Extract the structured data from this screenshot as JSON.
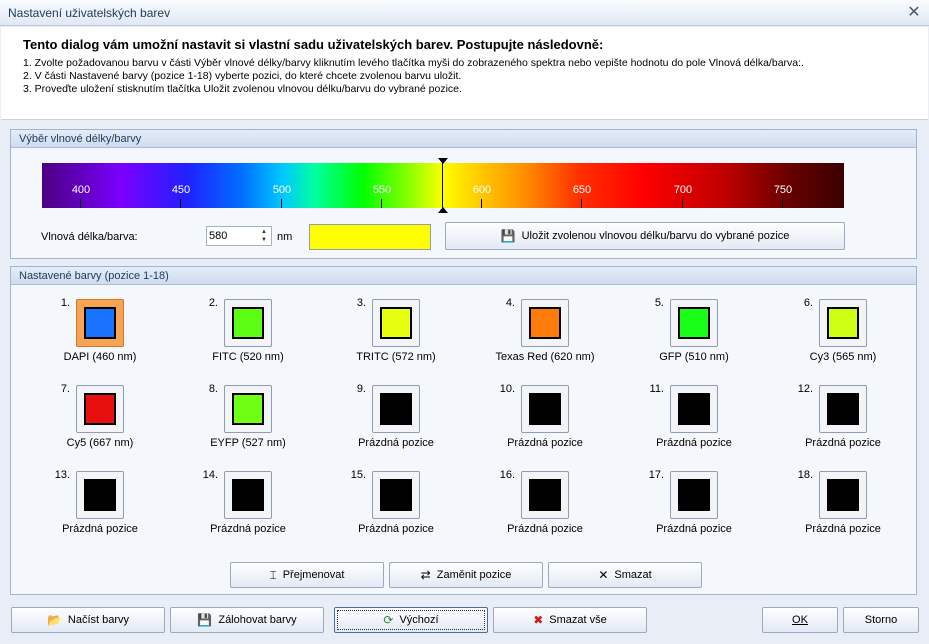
{
  "window": {
    "title": "Nastavení uživatelských barev"
  },
  "info": {
    "heading": "Tento dialog vám umožní nastavit si vlastní sadu uživatelských barev. Postupujte následovně:",
    "line1": "1. Zvolte požadovanou barvu v části Výběr vlnové délky/barvy kliknutím levého tlačítka myši do zobrazeného spektra nebo vepište hodnotu do pole Vlnová délka/barva:.",
    "line2": "2. V části Nastavené barvy (pozice 1-18) vyberte pozici, do které chcete zvolenou barvu uložit.",
    "line3": "3. Proveďte uložení stisknutím tlačítka Uložit zvolenou vlnovou délku/barvu do vybrané pozice."
  },
  "picker": {
    "title": "Výběr vlnové délky/barvy",
    "ticks": [
      "400",
      "450",
      "500",
      "550",
      "600",
      "650",
      "700",
      "750"
    ],
    "wavelength_label": "Vlnová délka/barva:",
    "wavelength_value": "580",
    "unit": "nm",
    "selected_color": "#ffff00",
    "save_button": "Uložit zvolenou vlnovou délku/barvu do vybrané pozice"
  },
  "presets": {
    "title": "Nastavené barvy (pozice 1-18)",
    "slots": [
      {
        "num": "1.",
        "name": "DAPI (460 nm)",
        "color": "#1a73ff"
      },
      {
        "num": "2.",
        "name": "FITC (520 nm)",
        "color": "#5cff14"
      },
      {
        "num": "3.",
        "name": "TRITC (572 nm)",
        "color": "#e6ff10"
      },
      {
        "num": "4.",
        "name": "Texas Red (620 nm)",
        "color": "#ff7b0a"
      },
      {
        "num": "5.",
        "name": "GFP (510 nm)",
        "color": "#1aff1a"
      },
      {
        "num": "6.",
        "name": "Cy3 (565 nm)",
        "color": "#ccff14"
      },
      {
        "num": "7.",
        "name": "Cy5 (667 nm)",
        "color": "#e80f0f"
      },
      {
        "num": "8.",
        "name": "EYFP (527 nm)",
        "color": "#6eff14"
      },
      {
        "num": "9.",
        "name": "Prázdná pozice",
        "color": "#000000"
      },
      {
        "num": "10.",
        "name": "Prázdná pozice",
        "color": "#000000"
      },
      {
        "num": "11.",
        "name": "Prázdná pozice",
        "color": "#000000"
      },
      {
        "num": "12.",
        "name": "Prázdná pozice",
        "color": "#000000"
      },
      {
        "num": "13.",
        "name": "Prázdná pozice",
        "color": "#000000"
      },
      {
        "num": "14.",
        "name": "Prázdná pozice",
        "color": "#000000"
      },
      {
        "num": "15.",
        "name": "Prázdná pozice",
        "color": "#000000"
      },
      {
        "num": "16.",
        "name": "Prázdná pozice",
        "color": "#000000"
      },
      {
        "num": "17.",
        "name": "Prázdná pozice",
        "color": "#000000"
      },
      {
        "num": "18.",
        "name": "Prázdná pozice",
        "color": "#000000"
      }
    ],
    "rename_button": "Přejmenovat",
    "swap_button": "Zaměnit pozice",
    "delete_button": "Smazat"
  },
  "footer": {
    "load_button": "Načíst barvy",
    "backup_button": "Zálohovat barvy",
    "default_button": "Výchozí",
    "delete_all_button": "Smazat vše",
    "ok_button": "OK",
    "cancel_button": "Storno"
  }
}
